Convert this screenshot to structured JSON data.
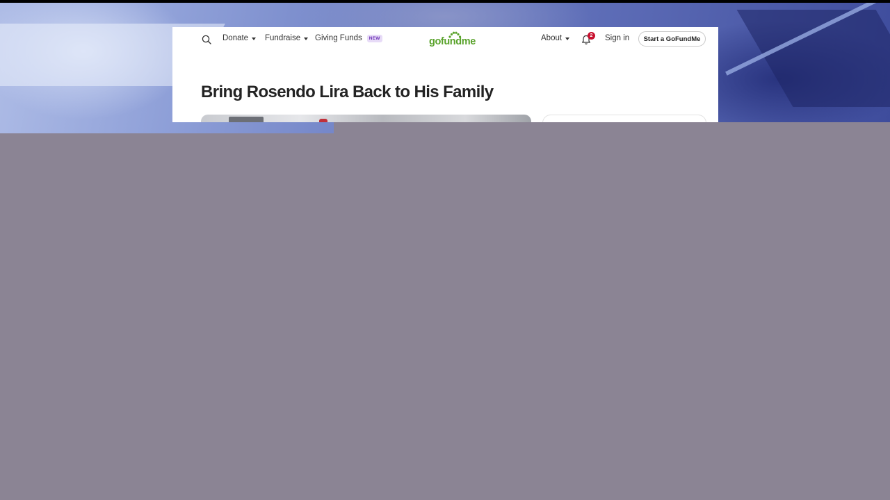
{
  "nav": {
    "donate_label": "Donate",
    "fundraise_label": "Fundraise",
    "giving_funds_label": "Giving Funds",
    "new_badge": "NEW",
    "logo_text": "gofundme",
    "about_label": "About",
    "notification_count": "2",
    "signin_label": "Sign in",
    "start_label": "Start a GoFundMe"
  },
  "campaign": {
    "title": "Bring Rosendo Lira Back to His Family"
  },
  "colors": {
    "brand_green": "#5aa32c",
    "badge_red": "#c8102e",
    "panel_mauve": "#8b8494",
    "new_badge_purple": "#6b2fb5"
  }
}
